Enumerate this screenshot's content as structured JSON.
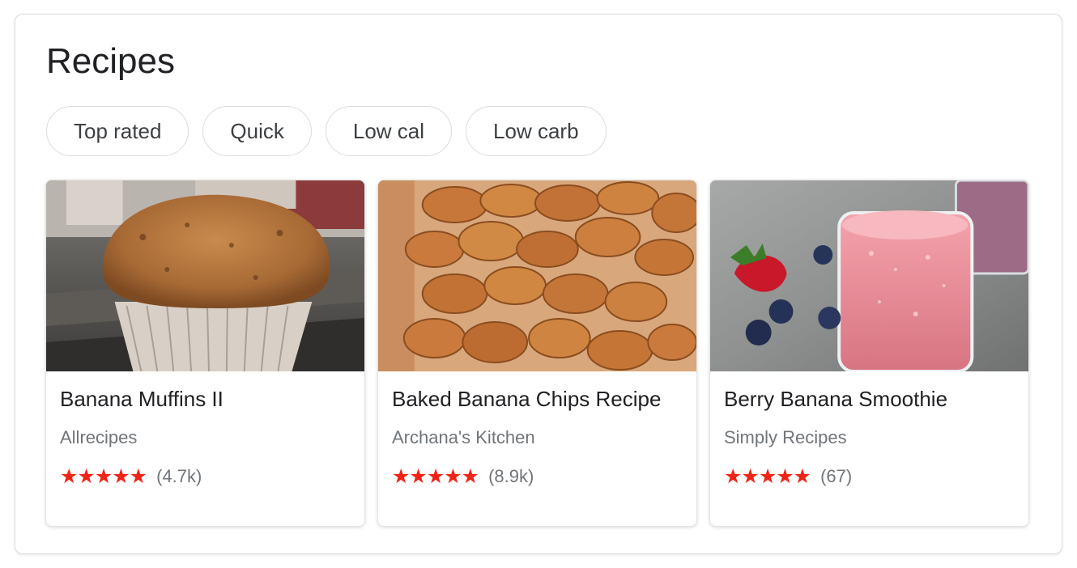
{
  "header": {
    "title": "Recipes"
  },
  "filters": [
    {
      "label": "Top rated"
    },
    {
      "label": "Quick"
    },
    {
      "label": "Low cal"
    },
    {
      "label": "Low carb"
    }
  ],
  "recipes": [
    {
      "title": "Banana Muffins II",
      "source": "Allrecipes",
      "stars": "★★★★★",
      "rating": 5,
      "count": "(4.7k)",
      "image": "muffin-photo"
    },
    {
      "title": "Baked Banana Chips Recipe",
      "source": "Archana's Kitchen",
      "stars": "★★★★★",
      "rating": 5,
      "count": "(8.9k)",
      "image": "banana-chips-photo"
    },
    {
      "title": "Berry Banana Smoothie",
      "source": "Simply Recipes",
      "stars": "★★★★★",
      "rating": 5,
      "count": "(67)",
      "image": "smoothie-photo"
    }
  ],
  "colors": {
    "star": "#ee2416",
    "border": "#dadce0",
    "title": "#202124",
    "muted": "#70757a"
  }
}
